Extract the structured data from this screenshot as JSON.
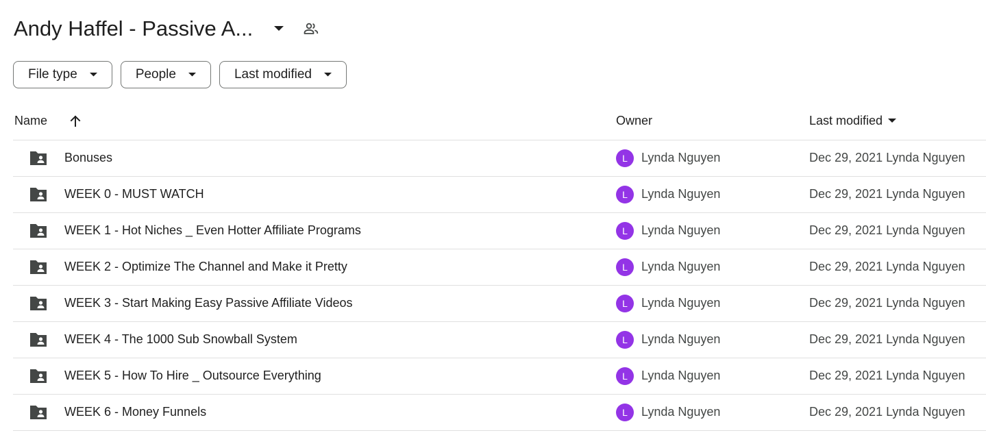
{
  "header": {
    "title": "Andy Haffel - Passive A...",
    "title_caret_icon": "caret-down-icon",
    "shared_icon": "shared-people-icon"
  },
  "filters": [
    {
      "label": "File type"
    },
    {
      "label": "People"
    },
    {
      "label": "Last modified"
    }
  ],
  "columns": {
    "name": "Name",
    "owner": "Owner",
    "last_modified": "Last modified",
    "sort_icon": "arrow-up-icon"
  },
  "rows": [
    {
      "name": "Bonuses",
      "avatar_letter": "L",
      "owner": "Lynda Nguyen",
      "modified": "Dec 29, 2021 Lynda Nguyen"
    },
    {
      "name": "WEEK 0 - MUST WATCH",
      "avatar_letter": "L",
      "owner": "Lynda Nguyen",
      "modified": "Dec 29, 2021 Lynda Nguyen"
    },
    {
      "name": "WEEK 1 - Hot Niches _ Even Hotter Affiliate Programs",
      "avatar_letter": "L",
      "owner": "Lynda Nguyen",
      "modified": "Dec 29, 2021 Lynda Nguyen"
    },
    {
      "name": "WEEK 2 - Optimize The Channel and Make it Pretty",
      "avatar_letter": "L",
      "owner": "Lynda Nguyen",
      "modified": "Dec 29, 2021 Lynda Nguyen"
    },
    {
      "name": "WEEK 3 - Start Making Easy Passive Affiliate Videos",
      "avatar_letter": "L",
      "owner": "Lynda Nguyen",
      "modified": "Dec 29, 2021 Lynda Nguyen"
    },
    {
      "name": "WEEK 4 - The 1000 Sub Snowball System",
      "avatar_letter": "L",
      "owner": "Lynda Nguyen",
      "modified": "Dec 29, 2021 Lynda Nguyen"
    },
    {
      "name": "WEEK 5 - How To Hire _ Outsource Everything",
      "avatar_letter": "L",
      "owner": "Lynda Nguyen",
      "modified": "Dec 29, 2021 Lynda Nguyen"
    },
    {
      "name": "WEEK 6 - Money Funnels",
      "avatar_letter": "L",
      "owner": "Lynda Nguyen",
      "modified": "Dec 29, 2021 Lynda Nguyen"
    }
  ],
  "colors": {
    "avatar": "#9334e6",
    "folder_icon": "#444746",
    "divider": "#e0e0e0"
  }
}
